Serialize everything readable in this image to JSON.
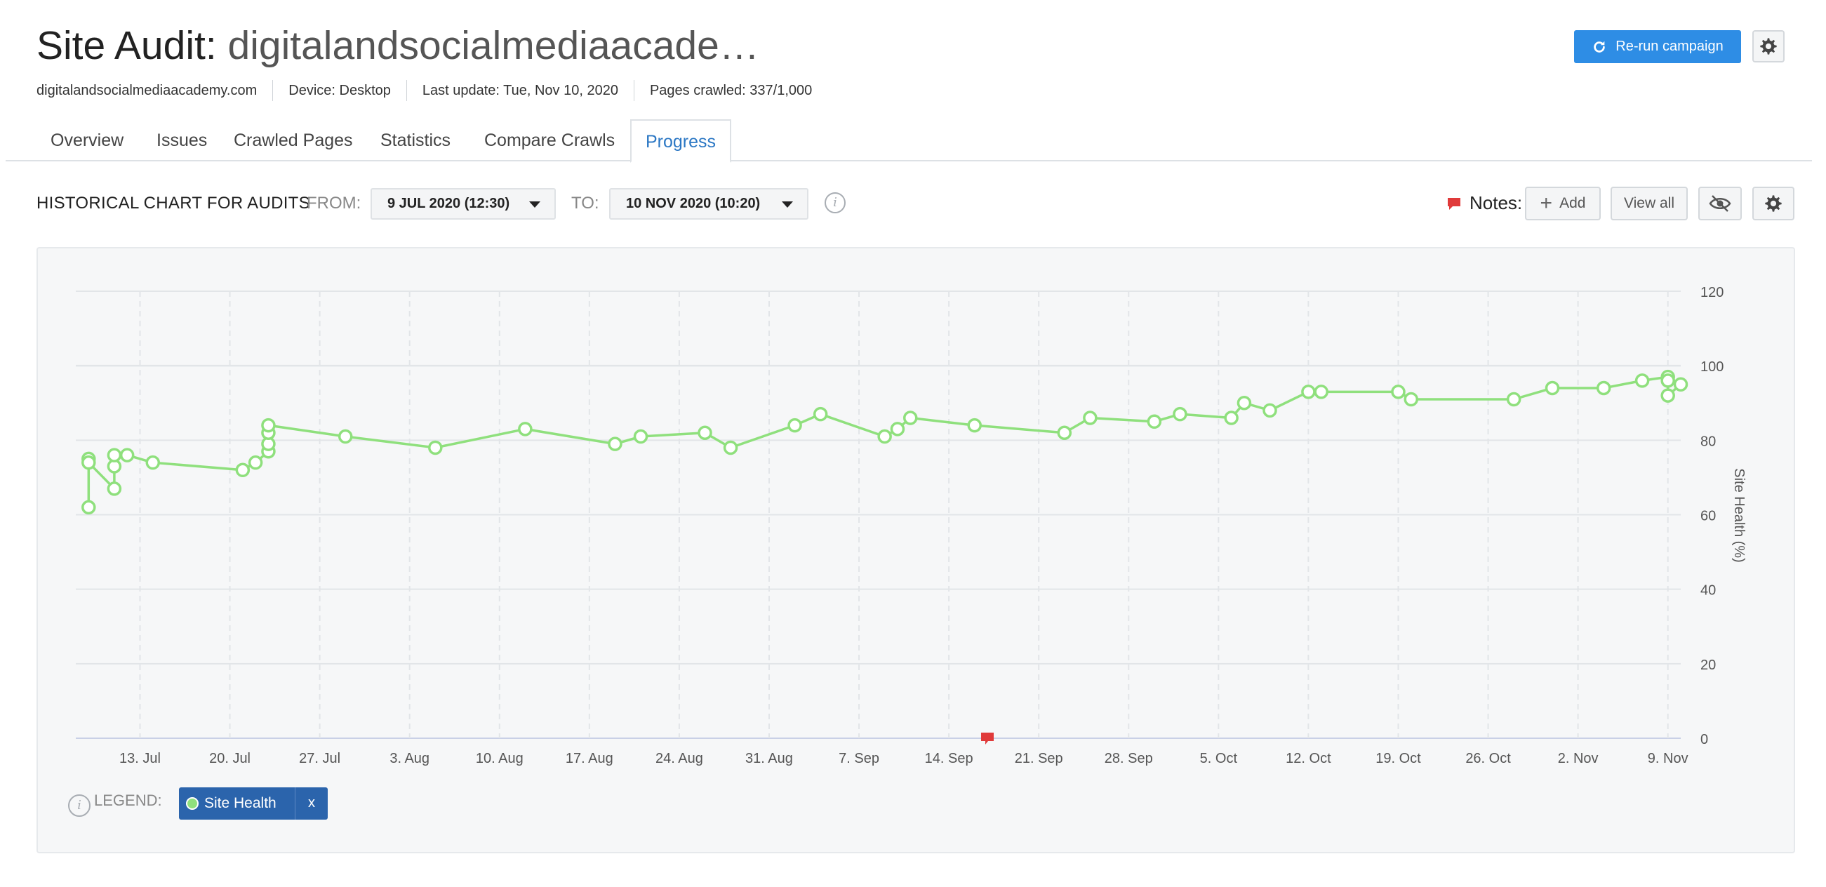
{
  "header": {
    "title_prefix": "Site Audit:",
    "title_domain": "digitalandsocialmediaacade…",
    "meta": {
      "domain": "digitalandsocialmediaacademy.com",
      "device": "Device: Desktop",
      "last_update": "Last update: Tue, Nov 10, 2020",
      "pages_crawled": "Pages crawled: 337/1,000"
    },
    "rerun_label": "Re-run campaign"
  },
  "tabs": [
    {
      "label": "Overview"
    },
    {
      "label": "Issues"
    },
    {
      "label": "Crawled Pages"
    },
    {
      "label": "Statistics"
    },
    {
      "label": "Compare Crawls"
    },
    {
      "label": "Progress",
      "active": true
    }
  ],
  "toolbar": {
    "title": "HISTORICAL CHART FOR AUDITS",
    "from_label": "FROM:",
    "from_value": "9 JUL 2020 (12:30)",
    "to_label": "TO:",
    "to_value": "10 NOV 2020 (10:20)",
    "notes_label": "Notes:",
    "add_label": "Add",
    "view_all_label": "View all"
  },
  "legend": {
    "label": "LEGEND:",
    "series_label": "Site Health",
    "remove_label": "x"
  },
  "colors": {
    "accent": "#2e8de5",
    "series": "#8fe07d",
    "note": "#e03a3a",
    "legend_chip": "#2b64ac"
  },
  "chart_data": {
    "type": "line",
    "ylabel": "Site Health (%)",
    "ylim": [
      0,
      120
    ],
    "yticks": [
      0,
      20,
      40,
      60,
      80,
      100,
      120
    ],
    "xlim": [
      "2020-07-08",
      "2020-11-10"
    ],
    "xticks": [
      "13. Jul",
      "20. Jul",
      "27. Jul",
      "3. Aug",
      "10. Aug",
      "17. Aug",
      "24. Aug",
      "31. Aug",
      "7. Sep",
      "14. Sep",
      "21. Sep",
      "28. Sep",
      "5. Oct",
      "12. Oct",
      "19. Oct",
      "26. Oct",
      "2. Nov",
      "9. Nov"
    ],
    "grid": true,
    "legend_position": "bottom-left",
    "notes": [
      "2020-09-17"
    ],
    "series": [
      {
        "name": "Site Health",
        "points": [
          [
            "2020-07-09",
            62
          ],
          [
            "2020-07-09",
            75
          ],
          [
            "2020-07-09",
            74
          ],
          [
            "2020-07-11",
            67
          ],
          [
            "2020-07-11",
            73
          ],
          [
            "2020-07-11",
            76
          ],
          [
            "2020-07-12",
            76
          ],
          [
            "2020-07-14",
            74
          ],
          [
            "2020-07-21",
            72
          ],
          [
            "2020-07-22",
            74
          ],
          [
            "2020-07-23",
            77
          ],
          [
            "2020-07-23",
            79
          ],
          [
            "2020-07-23",
            82
          ],
          [
            "2020-07-23",
            84
          ],
          [
            "2020-07-29",
            81
          ],
          [
            "2020-08-05",
            78
          ],
          [
            "2020-08-12",
            83
          ],
          [
            "2020-08-19",
            79
          ],
          [
            "2020-08-21",
            81
          ],
          [
            "2020-08-26",
            82
          ],
          [
            "2020-08-28",
            78
          ],
          [
            "2020-09-02",
            84
          ],
          [
            "2020-09-04",
            87
          ],
          [
            "2020-09-09",
            81
          ],
          [
            "2020-09-10",
            83
          ],
          [
            "2020-09-11",
            86
          ],
          [
            "2020-09-16",
            84
          ],
          [
            "2020-09-23",
            82
          ],
          [
            "2020-09-25",
            86
          ],
          [
            "2020-09-30",
            85
          ],
          [
            "2020-10-02",
            87
          ],
          [
            "2020-10-06",
            86
          ],
          [
            "2020-10-07",
            90
          ],
          [
            "2020-10-09",
            88
          ],
          [
            "2020-10-12",
            93
          ],
          [
            "2020-10-13",
            93
          ],
          [
            "2020-10-19",
            93
          ],
          [
            "2020-10-20",
            91
          ],
          [
            "2020-10-28",
            91
          ],
          [
            "2020-10-31",
            94
          ],
          [
            "2020-11-04",
            94
          ],
          [
            "2020-11-07",
            96
          ],
          [
            "2020-11-09",
            97
          ],
          [
            "2020-11-09",
            96
          ],
          [
            "2020-11-09",
            92
          ],
          [
            "2020-11-10",
            95
          ]
        ]
      }
    ]
  }
}
